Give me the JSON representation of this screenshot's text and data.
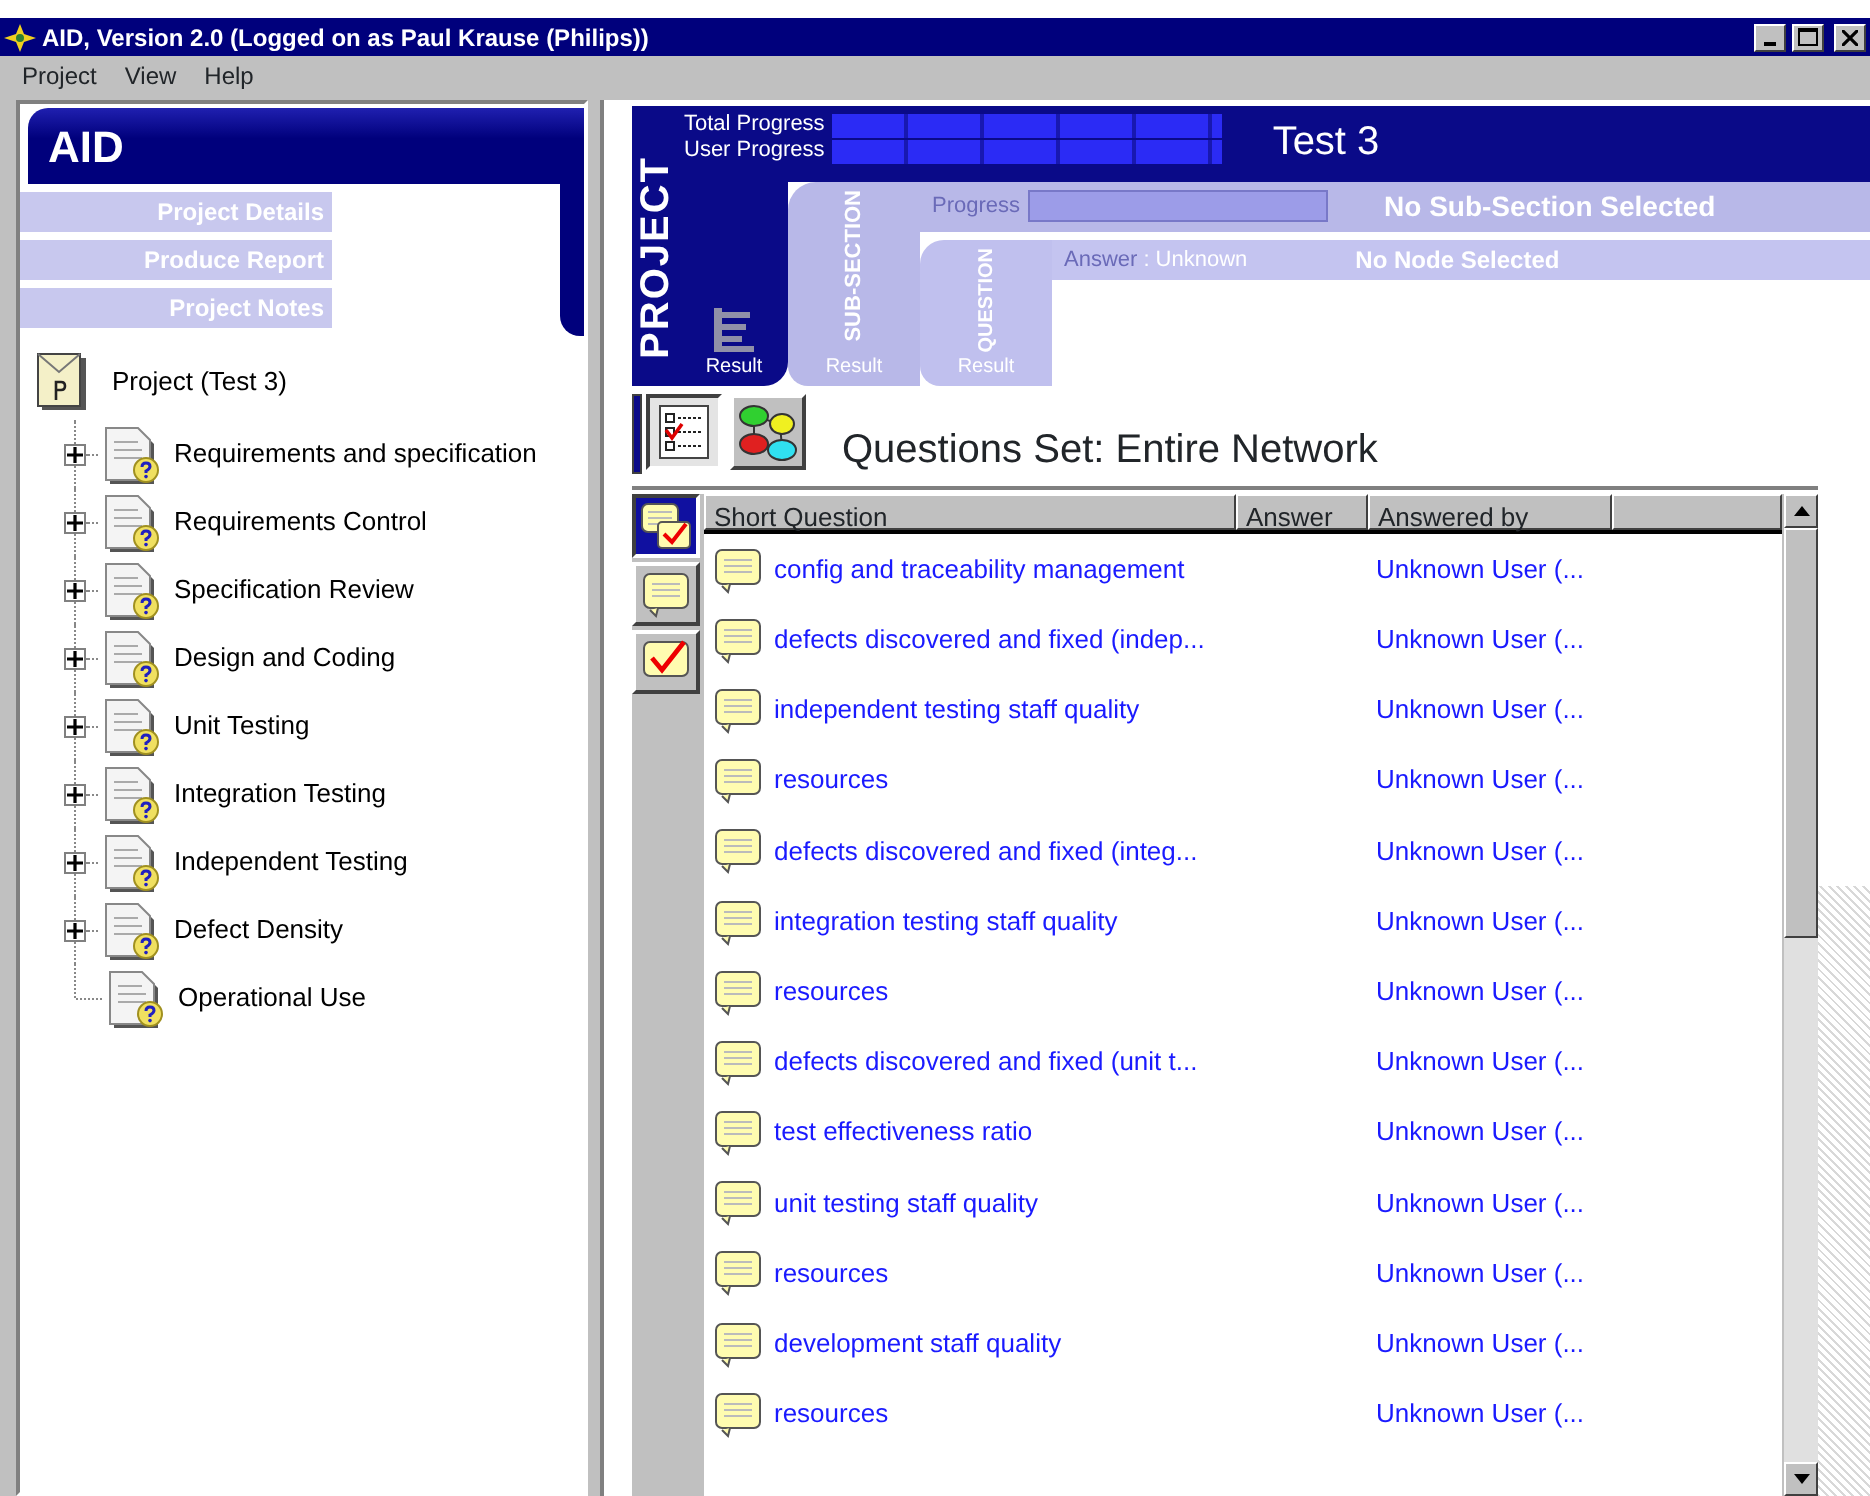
{
  "window": {
    "title": "AID, Version 2.0 (Logged on as Paul Krause (Philips))"
  },
  "menu": [
    "Project",
    "View",
    "Help"
  ],
  "sidebar": {
    "title": "AID",
    "links": [
      "Project Details",
      "Produce Report",
      "Project Notes"
    ],
    "tree": {
      "label": "Project (Test 3)",
      "children": [
        {
          "label": "Requirements and specification",
          "kind": "branch"
        },
        {
          "label": "Requirements Control",
          "kind": "branch"
        },
        {
          "label": "Specification Review",
          "kind": "branch"
        },
        {
          "label": "Design and Coding",
          "kind": "branch"
        },
        {
          "label": "Unit Testing",
          "kind": "branch"
        },
        {
          "label": "Integration Testing",
          "kind": "branch"
        },
        {
          "label": "Independent Testing",
          "kind": "branch"
        },
        {
          "label": "Defect Density",
          "kind": "branch"
        },
        {
          "label": "Operational Use",
          "kind": "leaf"
        }
      ]
    }
  },
  "project_panel": {
    "tab": "PROJECT",
    "result": "Result",
    "progress": [
      {
        "label": "Total Progress",
        "level": 1
      },
      {
        "label": "User Progress",
        "level": 1
      }
    ],
    "name": "Test 3"
  },
  "subsection_panel": {
    "tab": "SUB-SECTION",
    "result": "Result",
    "progress_label": "Progress",
    "level": 0,
    "status": "No Sub-Section Selected"
  },
  "question_panel": {
    "tab": "QUESTION",
    "result": "Result",
    "answer_label": "Answer",
    "answer_value": ": Unknown",
    "status": "No Node Selected"
  },
  "view_buttons": [
    {
      "kind": "list",
      "selected": true
    },
    {
      "kind": "network",
      "selected": false
    }
  ],
  "questions_title": "Questions Set: Entire Network",
  "filter_tabs": [
    {
      "kind": "all",
      "selected": true
    },
    {
      "kind": "unanswered",
      "selected": false
    },
    {
      "kind": "answered",
      "selected": false
    }
  ],
  "table": {
    "columns": [
      "Short Question",
      "Answer",
      "Answered by"
    ],
    "rows": [
      {
        "question": "config and traceability management",
        "answered_by": "Unknown User (..."
      },
      {
        "question": "defects discovered and fixed (indep...",
        "answered_by": "Unknown User (..."
      },
      {
        "question": "independent testing staff quality",
        "answered_by": "Unknown User (..."
      },
      {
        "question": "resources",
        "answered_by": "Unknown User (..."
      },
      {
        "question": "defects discovered and fixed (integ...",
        "answered_by": "Unknown User (..."
      },
      {
        "question": "integration testing staff quality",
        "answered_by": "Unknown User (..."
      },
      {
        "question": "resources",
        "answered_by": "Unknown User (..."
      },
      {
        "question": "defects discovered and fixed (unit t...",
        "answered_by": "Unknown User (..."
      },
      {
        "question": "test effectiveness ratio",
        "answered_by": "Unknown User (..."
      },
      {
        "question": "unit testing staff quality",
        "answered_by": "Unknown User (..."
      },
      {
        "question": "resources",
        "answered_by": "Unknown User (..."
      },
      {
        "question": "development staff quality",
        "answered_by": "Unknown User (..."
      },
      {
        "question": "resources",
        "answered_by": "Unknown User (..."
      }
    ]
  }
}
